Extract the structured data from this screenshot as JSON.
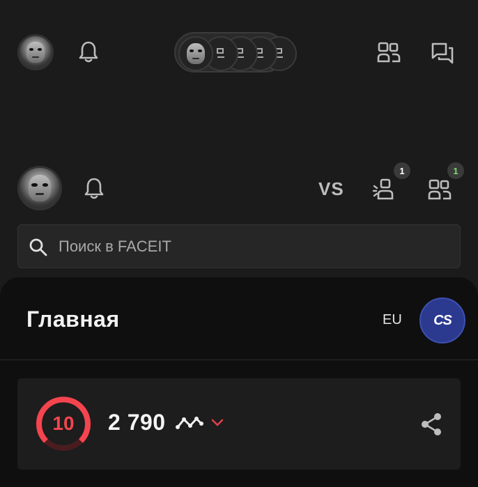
{
  "top_bar": {
    "avatar": "user-avatar",
    "notification_icon": "bell-icon",
    "party_slots": 4,
    "friends_icon": "friends-icon",
    "chat_icon": "chat-icon"
  },
  "header": {
    "vs_label": "VS",
    "party_invites_badge": "1",
    "friends_badge": "1"
  },
  "search": {
    "placeholder": "Поиск в FACEIT"
  },
  "home": {
    "title": "Главная",
    "region": "EU",
    "game_label": "CS"
  },
  "stats": {
    "level": "10",
    "elo": "2 790"
  },
  "colors": {
    "background": "#1b1b1b",
    "level_red": "#f4454f",
    "badge_green": "#7ddc6b",
    "game_blue": "#2b3a8f"
  }
}
